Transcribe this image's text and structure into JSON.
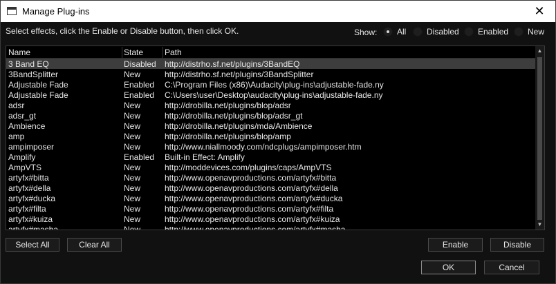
{
  "window": {
    "title": "Manage Plug-ins"
  },
  "icons": {
    "app": "window-icon",
    "close": "close-icon"
  },
  "instructions": "Select effects, click the Enable or Disable button, then click OK.",
  "show": {
    "label": "Show:",
    "options": [
      {
        "label": "All",
        "selected": true
      },
      {
        "label": "Disabled",
        "selected": false
      },
      {
        "label": "Enabled",
        "selected": false
      },
      {
        "label": "New",
        "selected": false
      }
    ]
  },
  "table": {
    "columns": [
      "Name",
      "State",
      "Path"
    ],
    "rows": [
      {
        "name": "3 Band EQ",
        "state": "Disabled",
        "path": "http://distrho.sf.net/plugins/3BandEQ",
        "selected": true
      },
      {
        "name": "3BandSplitter",
        "state": "New",
        "path": "http://distrho.sf.net/plugins/3BandSplitter"
      },
      {
        "name": "Adjustable Fade",
        "state": "Enabled",
        "path": "C:\\Program Files (x86)\\Audacity\\plug-ins\\adjustable-fade.ny"
      },
      {
        "name": "Adjustable Fade",
        "state": "Enabled",
        "path": "C:\\Users\\user\\Desktop\\audacity\\plug-ins\\adjustable-fade.ny"
      },
      {
        "name": "adsr",
        "state": "New",
        "path": "http://drobilla.net/plugins/blop/adsr"
      },
      {
        "name": "adsr_gt",
        "state": "New",
        "path": "http://drobilla.net/plugins/blop/adsr_gt"
      },
      {
        "name": "Ambience",
        "state": "New",
        "path": "http://drobilla.net/plugins/mda/Ambience"
      },
      {
        "name": "amp",
        "state": "New",
        "path": "http://drobilla.net/plugins/blop/amp"
      },
      {
        "name": "ampimposer",
        "state": "New",
        "path": "http://www.niallmoody.com/ndcplugs/ampimposer.htm"
      },
      {
        "name": "Amplify",
        "state": "Enabled",
        "path": "Built-in Effect: Amplify"
      },
      {
        "name": "AmpVTS",
        "state": "New",
        "path": "http://moddevices.com/plugins/caps/AmpVTS"
      },
      {
        "name": "artyfx#bitta",
        "state": "New",
        "path": "http://www.openavproductions.com/artyfx#bitta"
      },
      {
        "name": "artyfx#della",
        "state": "New",
        "path": "http://www.openavproductions.com/artyfx#della"
      },
      {
        "name": "artyfx#ducka",
        "state": "New",
        "path": "http://www.openavproductions.com/artyfx#ducka"
      },
      {
        "name": "artyfx#filta",
        "state": "New",
        "path": "http://www.openavproductions.com/artyfx#filta"
      },
      {
        "name": "artyfx#kuiza",
        "state": "New",
        "path": "http://www.openavproductions.com/artyfx#kuiza"
      },
      {
        "name": "artyfx#masha",
        "state": "New",
        "path": "http://www.openavproductions.com/artyfx#masha"
      }
    ]
  },
  "buttons": {
    "select_all": "Select All",
    "clear_all": "Clear All",
    "enable": "Enable",
    "disable": "Disable",
    "ok": "OK",
    "cancel": "Cancel"
  },
  "colors": {
    "background": "#111111",
    "list_background": "#000000",
    "selected_row": "#3d3d3d",
    "text": "#e8e8e8",
    "titlebar": "#ffffff"
  }
}
